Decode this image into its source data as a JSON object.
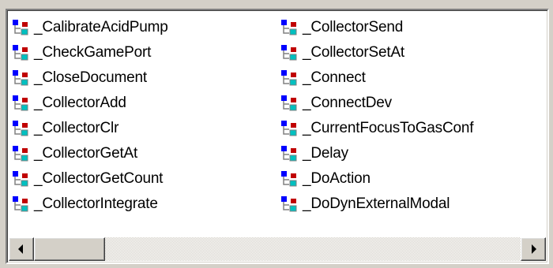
{
  "list": {
    "columns": [
      {
        "items": [
          {
            "label": "_CalibrateAcidPump",
            "icon": "function-module-icon"
          },
          {
            "label": "_CheckGamePort",
            "icon": "function-module-icon"
          },
          {
            "label": "_CloseDocument",
            "icon": "function-module-icon"
          },
          {
            "label": "_CollectorAdd",
            "icon": "function-module-icon"
          },
          {
            "label": "_CollectorClr",
            "icon": "function-module-icon"
          },
          {
            "label": "_CollectorGetAt",
            "icon": "function-module-icon"
          },
          {
            "label": "_CollectorGetCount",
            "icon": "function-module-icon"
          },
          {
            "label": "_CollectorIntegrate",
            "icon": "function-module-icon"
          }
        ]
      },
      {
        "items": [
          {
            "label": "_CollectorSend",
            "icon": "function-module-icon"
          },
          {
            "label": "_CollectorSetAt",
            "icon": "function-module-icon"
          },
          {
            "label": "_Connect",
            "icon": "function-module-icon"
          },
          {
            "label": "_ConnectDev",
            "icon": "function-module-icon"
          },
          {
            "label": "_CurrentFocusToGasConf",
            "icon": "function-module-icon"
          },
          {
            "label": "_Delay",
            "icon": "function-module-icon"
          },
          {
            "label": "_DoAction",
            "icon": "function-module-icon"
          },
          {
            "label": "_DoDynExternalModal",
            "icon": "function-module-icon"
          }
        ]
      }
    ]
  },
  "icon_colors": {
    "blue": "#0000ff",
    "red": "#c00000",
    "cyan": "#00c0c0",
    "line": "#808080"
  },
  "scrollbar": {
    "left_icon": "arrow-left-icon",
    "right_icon": "arrow-right-icon"
  }
}
